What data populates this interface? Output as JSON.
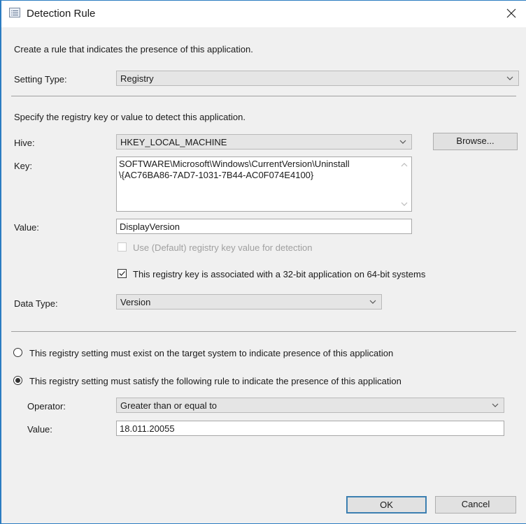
{
  "window": {
    "title": "Detection Rule",
    "close_icon": "close-icon",
    "title_icon": "list-window-icon"
  },
  "intro": "Create a rule that indicates the presence of this application.",
  "setting_type": {
    "label": "Setting Type:",
    "value": "Registry"
  },
  "registry": {
    "instructions": "Specify the registry key or value to detect this application.",
    "hive": {
      "label": "Hive:",
      "value": "HKEY_LOCAL_MACHINE"
    },
    "browse_label": "Browse...",
    "key": {
      "label": "Key:",
      "line1": "SOFTWARE\\Microsoft\\Windows\\CurrentVersion\\Uninstall",
      "line2": "\\{AC76BA86-7AD7-1031-7B44-AC0F074E4100}"
    },
    "value": {
      "label": "Value:",
      "value": "DisplayVersion"
    },
    "use_default": {
      "label": "Use (Default) registry key value for detection",
      "checked": false,
      "enabled": false
    },
    "is_32bit": {
      "label": "This registry key is associated with a 32-bit application on 64-bit systems",
      "checked": true
    },
    "data_type": {
      "label": "Data Type:",
      "value": "Version"
    }
  },
  "rule": {
    "option_exist": {
      "label": "This registry setting must exist on the target system to indicate presence of this application",
      "selected": false
    },
    "option_satisfy": {
      "label": "This registry setting must satisfy the following rule to indicate the presence of this application",
      "selected": true
    },
    "operator": {
      "label": "Operator:",
      "value": "Greater than or equal to"
    },
    "value": {
      "label": "Value:",
      "value": "18.011.20055"
    }
  },
  "footer": {
    "ok_label": "OK",
    "cancel_label": "Cancel"
  }
}
